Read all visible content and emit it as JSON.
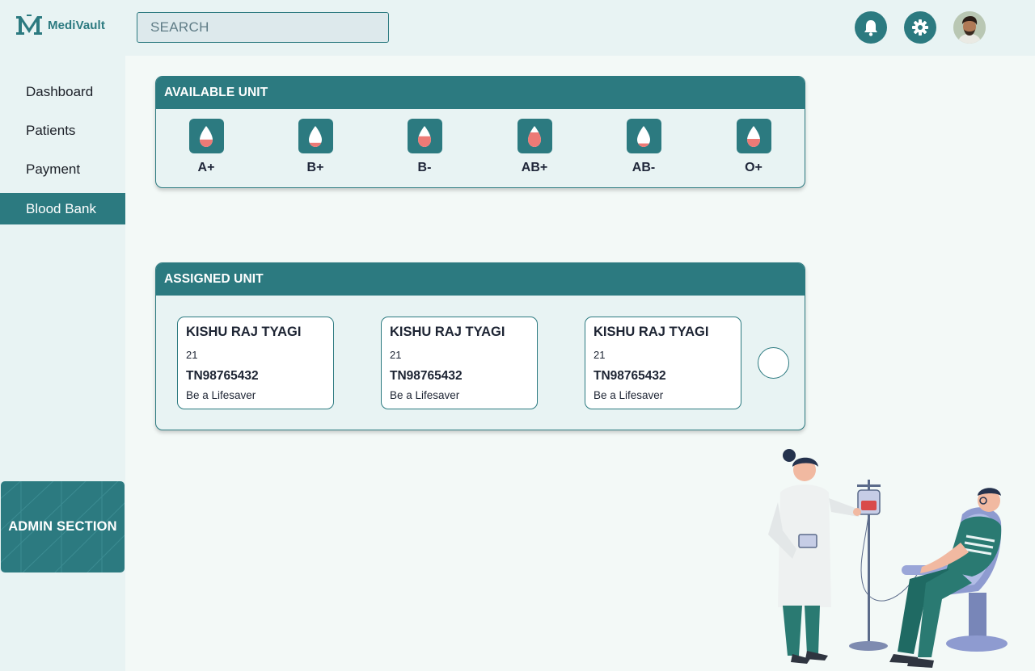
{
  "header": {
    "brand": "MediVault",
    "search_placeholder": "SEARCH",
    "icons": [
      "bell-icon",
      "gear-icon",
      "user-avatar"
    ]
  },
  "sidebar": {
    "items": [
      {
        "label": "Dashboard",
        "active": false
      },
      {
        "label": "Patients",
        "active": false
      },
      {
        "label": "Payment",
        "active": false
      },
      {
        "label": "Blood Bank",
        "active": true
      }
    ],
    "admin_label": "ADMIN SECTION"
  },
  "available": {
    "title": "AVAILABLE UNIT",
    "units": [
      {
        "type": "A+",
        "icon": "blood-drop-icon",
        "fill_level": 0.45
      },
      {
        "type": "B+",
        "icon": "blood-drop-icon",
        "fill_level": 0.2
      },
      {
        "type": "B-",
        "icon": "blood-drop-icon",
        "fill_level": 0.7
      },
      {
        "type": "AB+",
        "icon": "blood-drop-icon",
        "fill_level": 1.0
      },
      {
        "type": "AB-",
        "icon": "blood-drop-icon",
        "fill_level": 0.15
      },
      {
        "type": "O+",
        "icon": "blood-drop-icon",
        "fill_level": 0.5
      }
    ]
  },
  "assigned": {
    "title": "ASSIGNED UNIT",
    "cards": [
      {
        "name": "KISHU RAJ TYAGI",
        "age": "21",
        "id": "TN98765432",
        "tagline": "Be a Lifesaver"
      },
      {
        "name": "KISHU RAJ TYAGI",
        "age": "21",
        "id": "TN98765432",
        "tagline": "Be a Lifesaver"
      },
      {
        "name": "KISHU RAJ TYAGI",
        "age": "21",
        "id": "TN98765432",
        "tagline": "Be a Lifesaver"
      }
    ]
  },
  "colors": {
    "primary": "#2c7a80",
    "background": "#f3f9f7",
    "panel": "#e8f3f3",
    "blood": "#ec7a76"
  }
}
